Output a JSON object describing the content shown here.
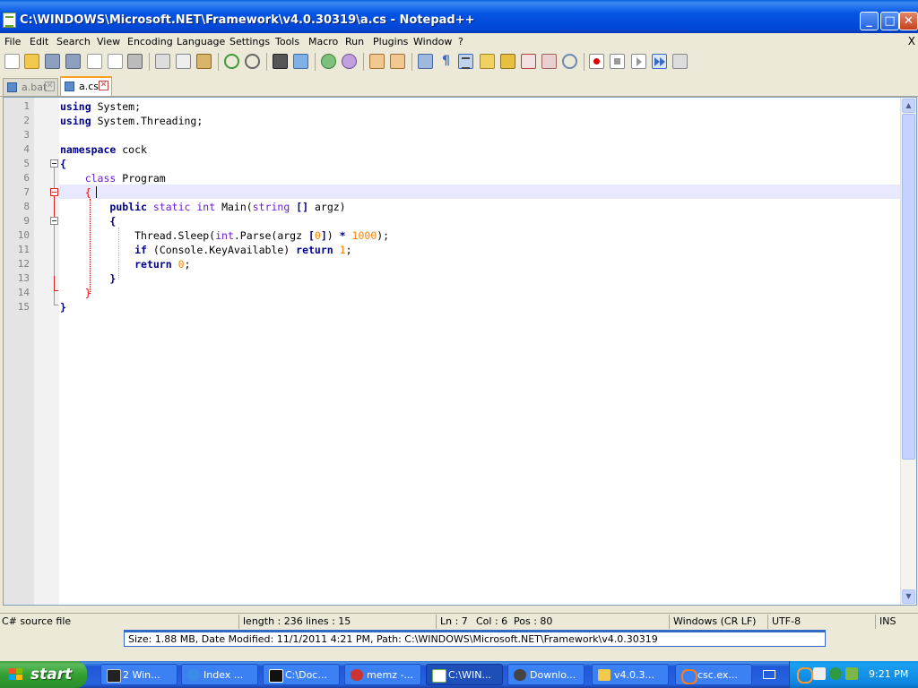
{
  "window": {
    "title": "C:\\WINDOWS\\Microsoft.NET\\Framework\\v4.0.30319\\a.cs - Notepad++",
    "minimize_glyph": "_",
    "maximize_glyph": "□",
    "close_glyph": "✕"
  },
  "menu": {
    "items": [
      "File",
      "Edit",
      "Search",
      "View",
      "Encoding",
      "Language",
      "Settings",
      "Tools",
      "Macro",
      "Run",
      "Plugins",
      "Window",
      "?"
    ],
    "close_glyph": "X"
  },
  "toolbar": {
    "icons": [
      "new-file-icon",
      "open-file-icon",
      "save-icon",
      "save-all-icon",
      "close-icon",
      "close-all-icon",
      "print-icon",
      "cut-icon",
      "copy-icon",
      "paste-icon",
      "undo-icon",
      "redo-icon",
      "find-icon",
      "replace-icon",
      "zoom-in-icon",
      "zoom-out-icon",
      "sync-vertical-icon",
      "sync-horizontal-icon",
      "word-wrap-icon",
      "show-all-chars-icon",
      "indent-guide-icon",
      "user-lang-icon",
      "doc-map-icon",
      "function-list-icon",
      "folder-workspace-icon",
      "monitor-icon",
      "record-macro-icon",
      "stop-macro-icon",
      "play-macro-icon",
      "run-macro-multiple-icon",
      "save-macro-icon"
    ]
  },
  "tabs": [
    {
      "label": "a.bat",
      "active": false
    },
    {
      "label": "a.cs",
      "active": true
    }
  ],
  "editor": {
    "line_numbers": [
      "1",
      "2",
      "3",
      "4",
      "5",
      "6",
      "7",
      "8",
      "9",
      "10",
      "11",
      "12",
      "13",
      "14",
      "15"
    ],
    "current_line": 7,
    "lines": [
      [
        [
          "kw",
          "using"
        ],
        [
          "",
          "System;"
        ]
      ],
      [
        [
          "kw",
          "using"
        ],
        [
          "",
          "System.Threading;"
        ]
      ],
      [],
      [
        [
          "kw",
          "namespace"
        ],
        [
          "",
          "cock"
        ]
      ],
      [
        [
          "op",
          "{"
        ]
      ],
      [
        [
          "",
          "    "
        ],
        [
          "kw2",
          "class"
        ],
        [
          "",
          "Program"
        ]
      ],
      [
        [
          "",
          "    "
        ],
        [
          "brace-red",
          "{"
        ]
      ],
      [
        [
          "",
          "        "
        ],
        [
          "kw",
          "public"
        ],
        [
          "kw2",
          "static"
        ],
        [
          "kw2",
          "int"
        ],
        [
          "",
          "Main("
        ],
        [
          "kw2",
          "string"
        ],
        [
          "op",
          "[]"
        ],
        [
          "",
          "argz)"
        ]
      ],
      [
        [
          "",
          "        "
        ],
        [
          "op",
          "{"
        ]
      ],
      [
        [
          "",
          "            Thread.Sleep("
        ],
        [
          "kw2",
          "int"
        ],
        [
          "",
          ".Parse(argz"
        ],
        [
          "op",
          "["
        ],
        [
          "num",
          "0"
        ],
        [
          "op",
          "]"
        ],
        [
          "",
          ")"
        ],
        [
          "op",
          "*"
        ],
        [
          "num",
          "1000"
        ],
        [
          "",
          ");"
        ]
      ],
      [
        [
          "",
          "            "
        ],
        [
          "kw",
          "if"
        ],
        [
          "",
          "(Console.KeyAvailable)"
        ],
        [
          "kw",
          "return"
        ],
        [
          "num",
          "1"
        ],
        [
          "",
          ";"
        ]
      ],
      [
        [
          "",
          "            "
        ],
        [
          "kw",
          "return"
        ],
        [
          "num",
          "0"
        ],
        [
          "",
          ";"
        ]
      ],
      [
        [
          "",
          "        "
        ],
        [
          "op",
          "}"
        ]
      ],
      [
        [
          "",
          "    "
        ],
        [
          "brace-red",
          "}"
        ]
      ],
      [
        [
          "op",
          "}"
        ]
      ]
    ]
  },
  "statusbar": {
    "filetype": "C# source file",
    "length": "length : 236",
    "lines": "lines : 15",
    "ln": "Ln : 7",
    "col": "Col : 6",
    "pos": "Pos : 80",
    "eol": "Windows (CR LF)",
    "encoding": "UTF-8",
    "mode": "INS"
  },
  "infobar": {
    "text": "Size: 1.88 MB, Date Modified: 11/1/2011 4:21 PM, Path: C:\\WINDOWS\\Microsoft.NET\\Framework\\v4.0.30319"
  },
  "taskbar": {
    "start_label": "start",
    "tasks": [
      {
        "label": "2 Win...",
        "icon": "cmd-icon",
        "color": "#222222"
      },
      {
        "label": "Index ...",
        "icon": "ie-icon",
        "color": "#3a8ce8"
      },
      {
        "label": "C:\\Doc...",
        "icon": "7zip-icon",
        "color": "#111111"
      },
      {
        "label": "memz -...",
        "icon": "memz-icon",
        "color": "#cc3333"
      },
      {
        "label": "C:\\WIN...",
        "icon": "notepadpp-icon",
        "color": "#7ab648",
        "active": true
      },
      {
        "label": "Downlo...",
        "icon": "download-icon",
        "color": "#444444"
      },
      {
        "label": "v4.0.3...",
        "icon": "folder-icon",
        "color": "#f2c94c"
      },
      {
        "label": "csc.ex...",
        "icon": "search-icon",
        "color": "#ff7a1a"
      }
    ],
    "clock": "9:21 PM",
    "tray_icons": [
      "search-tray-icon",
      "hfs-icon",
      "network-icon",
      "sync-tray-icon"
    ]
  }
}
